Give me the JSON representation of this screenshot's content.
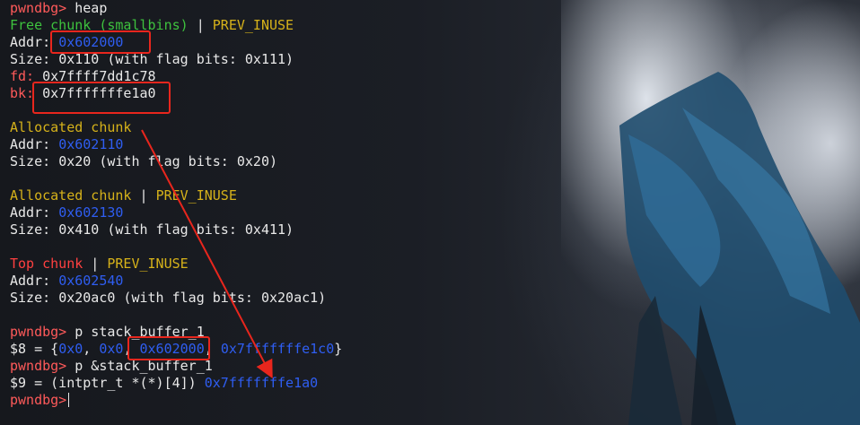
{
  "terminal": {
    "prompt": "pwndbg>",
    "cmd_heap": " heap",
    "free_chunk": {
      "title": "Free chunk (smallbins)",
      "sep": " | ",
      "flag": "PREV_INUSE",
      "addr_label": "Addr: ",
      "addr": "0x602000",
      "size_label": "Size: ",
      "size": "0x110 (with flag bits: 0x111)",
      "fd_label": "fd: ",
      "fd": "0x7ffff7dd1c78",
      "bk_label": "bk: ",
      "bk": "0x7fffffffe1a0"
    },
    "alloc1": {
      "title": "Allocated chunk",
      "addr_label": "Addr: ",
      "addr": "0x602110",
      "size_label": "Size: ",
      "size": "0x20 (with flag bits: 0x20)"
    },
    "alloc2": {
      "title": "Allocated chunk",
      "sep": " | ",
      "flag": "PREV_INUSE",
      "addr_label": "Addr: ",
      "addr": "0x602130",
      "size_label": "Size: ",
      "size": "0x410 (with flag bits: 0x411)"
    },
    "top": {
      "title": "Top chunk",
      "sep": " | ",
      "flag": "PREV_INUSE",
      "addr_label": "Addr: ",
      "addr": "0x602540",
      "size_label": "Size: ",
      "size": "0x20ac0 (with flag bits: 0x20ac1)"
    },
    "cmd_p1": " p stack_buffer_1",
    "out8": {
      "prefix": "$8 = {",
      "v0": "0x0",
      "comma": ", ",
      "v1": "0x0",
      "v2": "0x602000",
      "v3": "0x7fffffffe1c0",
      "suffix": "}"
    },
    "cmd_p2": " p &stack_buffer_1",
    "out9": {
      "prefix": "$9 = (intptr_t *(*)[4]) ",
      "val": "0x7fffffffe1a0"
    }
  },
  "colors": {
    "prompt": "#ff5a5a",
    "free": "#3ec23e",
    "flag": "#d6b21a",
    "top": "#ff4040",
    "address": "#2f5ef2",
    "annotation": "#e8261d"
  }
}
